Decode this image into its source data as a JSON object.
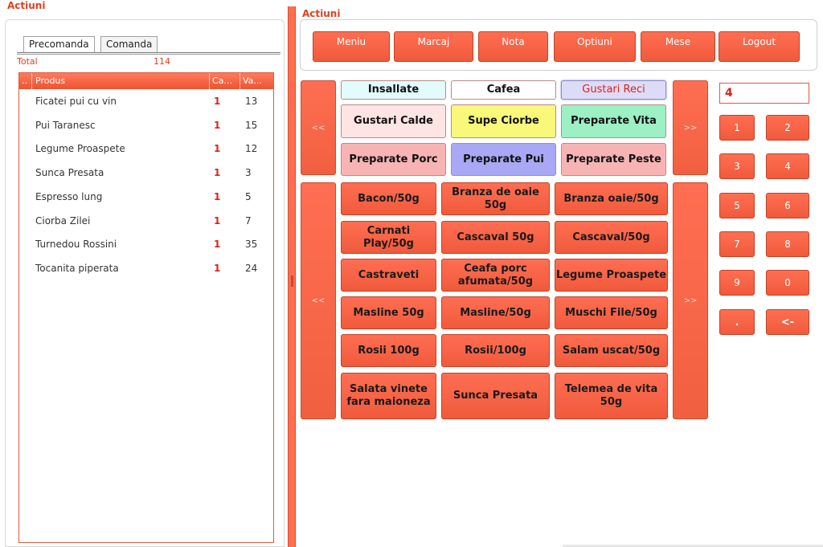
{
  "left": {
    "title": "Actiuni",
    "tabs": [
      "Precomanda",
      "Comanda"
    ],
    "total_label": "Total",
    "total_value": "114",
    "columns": [
      "..",
      "Produs",
      "Ca...",
      "Va..."
    ],
    "rows": [
      {
        "produs": "Ficatei pui cu vin",
        "cant": "1",
        "val": "13"
      },
      {
        "produs": "Pui Taranesc",
        "cant": "1",
        "val": "15"
      },
      {
        "produs": "Legume Proaspete",
        "cant": "1",
        "val": "12"
      },
      {
        "produs": "Sunca Presata",
        "cant": "1",
        "val": "3"
      },
      {
        "produs": "Espresso lung",
        "cant": "1",
        "val": "5"
      },
      {
        "produs": "Ciorba Zilei",
        "cant": "1",
        "val": "7"
      },
      {
        "produs": "Turnedou Rossini",
        "cant": "1",
        "val": "35"
      },
      {
        "produs": "Tocanita piperata",
        "cant": "1",
        "val": "24"
      }
    ]
  },
  "right": {
    "title": "Actiuni",
    "menu": [
      "Meniu",
      "Marcaj",
      "Nota",
      "Optiuni",
      "Mese",
      "Logout"
    ],
    "nav_prev": "<<",
    "nav_next": ">>",
    "categories": [
      {
        "label": "Insallate",
        "color": "#e2fbfb"
      },
      {
        "label": "Cafea",
        "color": "#ffffff"
      },
      {
        "label": "Gustari Reci",
        "color": "#dcdcf6"
      },
      {
        "label": "Gustari Calde",
        "color": "#ffe4e4"
      },
      {
        "label": "Supe Ciorbe",
        "color": "#f8f87a"
      },
      {
        "label": "Preparate Vita",
        "color": "#9cf0c4"
      },
      {
        "label": "Preparate Porc",
        "color": "#f8b4b4"
      },
      {
        "label": "Preparate Pui",
        "color": "#a8a8f4"
      },
      {
        "label": "Preparate Peste",
        "color": "#f8b4b4"
      }
    ],
    "products": [
      "Bacon/50g",
      "Branza de oaie 50g",
      "Branza oaie/50g",
      "Carnati Play/50g",
      "Cascaval 50g",
      "Cascaval/50g",
      "Castraveti",
      "Ceafa porc afumata/50g",
      "Legume Proaspete",
      "Masline 50g",
      "Masline/50g",
      "Muschi File/50g",
      "Rosii 100g",
      "Rosii/100g",
      "Salam uscat/50g",
      "Salata vinete fara maioneza",
      "Sunca Presata",
      "Telemea de vita 50g"
    ],
    "quantity": "4",
    "keypad": [
      "1",
      "2",
      "3",
      "4",
      "5",
      "6",
      "7",
      "8",
      "9",
      "0",
      ".",
      "<-"
    ]
  }
}
